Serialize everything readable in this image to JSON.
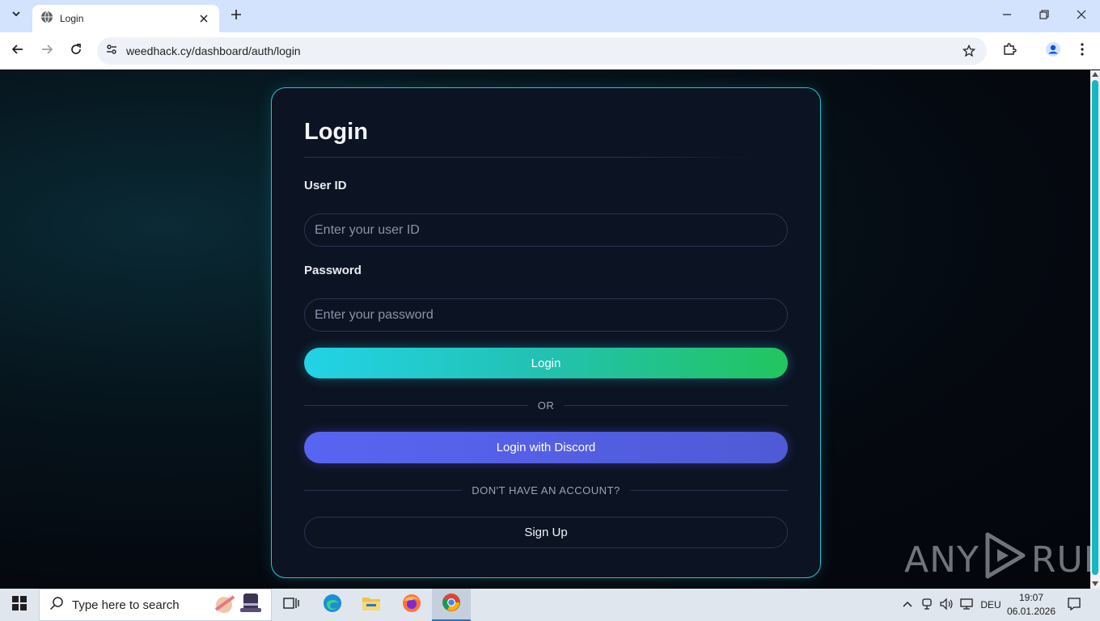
{
  "browser": {
    "tab_title": "Login",
    "url": "weedhack.cy/dashboard/auth/login"
  },
  "page": {
    "title": "Login",
    "user_id_label": "User ID",
    "user_id_placeholder": "Enter your user ID",
    "password_label": "Password",
    "password_placeholder": "Enter your password",
    "login_button": "Login",
    "or_divider": "OR",
    "discord_button": "Login with Discord",
    "no_account_divider": "DON'T HAVE AN ACCOUNT?",
    "signup_button": "Sign Up"
  },
  "watermark": {
    "left": "ANY",
    "right": "RUN"
  },
  "taskbar": {
    "search_placeholder": "Type here to search",
    "language": "DEU",
    "time": "19:07",
    "date": "06.01.2026"
  },
  "colors": {
    "accent_cyan": "#22d3e6",
    "accent_green": "#22c55e",
    "discord": "#5865f2",
    "card_border": "#22c5d5"
  }
}
